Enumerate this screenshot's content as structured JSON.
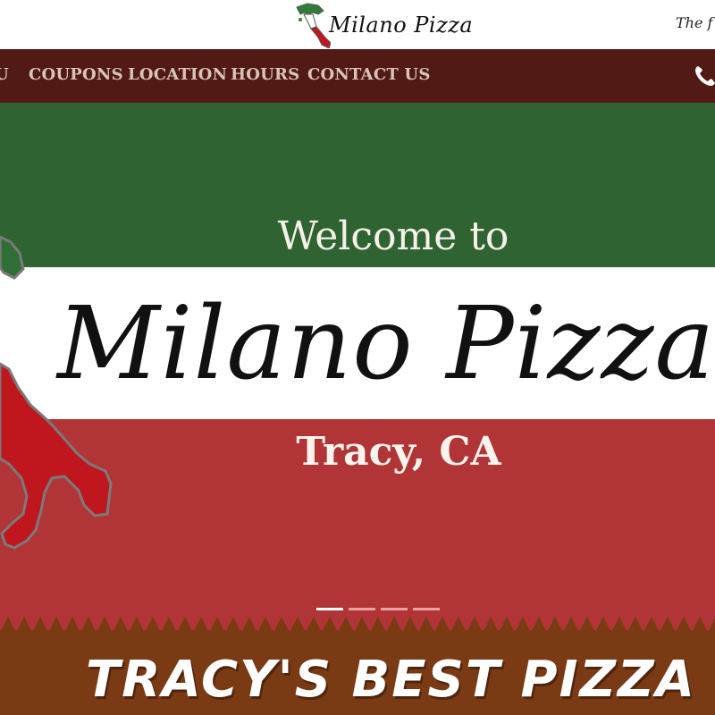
{
  "header": {
    "logo_text": "Milano Pizza",
    "tagline": "The f"
  },
  "nav": {
    "items": [
      {
        "label": "U"
      },
      {
        "label": "COUPONS"
      },
      {
        "label": "LOCATION"
      },
      {
        "label": "HOURS"
      },
      {
        "label": "CONTACT US"
      }
    ],
    "phone_icon": "phone-icon"
  },
  "hero": {
    "welcome": "Welcome to",
    "brand": "Milano Pizza",
    "city": "Tracy, CA",
    "slides_total": 4,
    "active_slide": 1,
    "colors": {
      "green": "#2f6432",
      "white": "#ffffff",
      "red": "#b13536"
    }
  },
  "banner": {
    "title": "TRACY'S BEST PIZZA",
    "color": "#7a3a14"
  }
}
